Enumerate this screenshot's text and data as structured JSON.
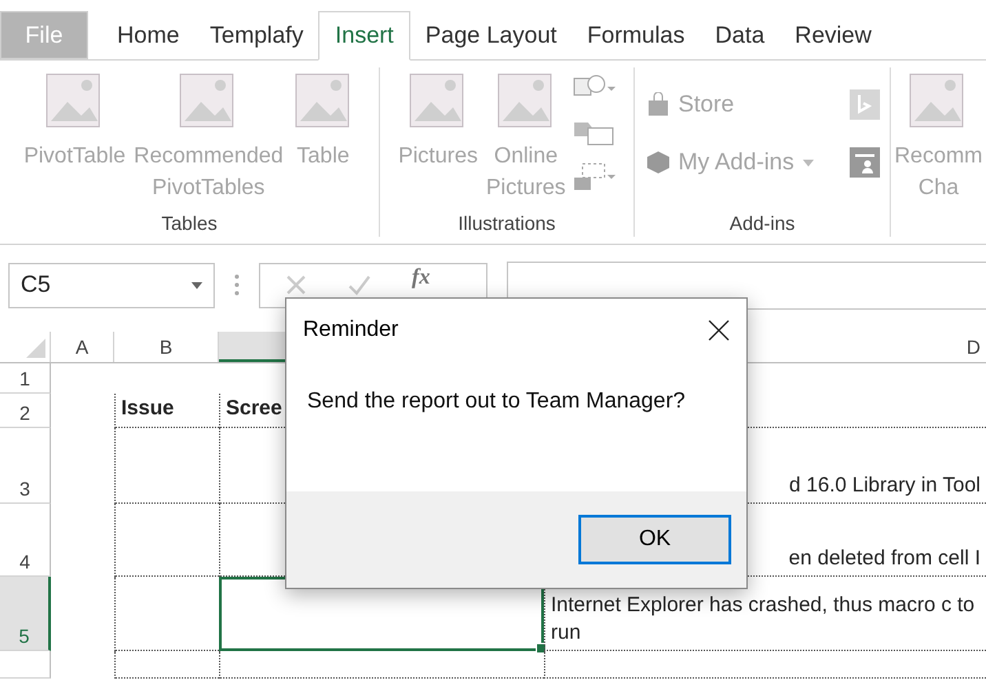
{
  "tabs": [
    {
      "label": "File",
      "kind": "file",
      "selected": false
    },
    {
      "label": "Home",
      "kind": "tab",
      "selected": false
    },
    {
      "label": "Templafy",
      "kind": "tab",
      "selected": false
    },
    {
      "label": "Insert",
      "kind": "tab",
      "selected": true
    },
    {
      "label": "Page Layout",
      "kind": "tab",
      "selected": false
    },
    {
      "label": "Formulas",
      "kind": "tab",
      "selected": false
    },
    {
      "label": "Data",
      "kind": "tab",
      "selected": false
    },
    {
      "label": "Review",
      "kind": "tab",
      "selected": false
    }
  ],
  "ribbon": {
    "groups": [
      {
        "label": "Tables",
        "items": [
          {
            "kind": "large",
            "lines": [
              "PivotTable"
            ]
          },
          {
            "kind": "large",
            "lines": [
              "Recommended",
              "PivotTables"
            ]
          },
          {
            "kind": "large",
            "lines": [
              "Table"
            ]
          }
        ]
      },
      {
        "label": "Illustrations",
        "items": [
          {
            "kind": "large",
            "lines": [
              "Pictures"
            ]
          },
          {
            "kind": "large",
            "lines": [
              "Online",
              "Pictures"
            ]
          },
          {
            "kind": "stack"
          }
        ]
      },
      {
        "label": "Add-ins",
        "items": [
          {
            "kind": "addins",
            "lines": [
              "Store",
              "My Add-ins"
            ]
          }
        ]
      },
      {
        "items": [
          {
            "kind": "large",
            "lines": [
              "Recomm",
              "Cha"
            ]
          }
        ]
      }
    ]
  },
  "formula_bar": {
    "name_box": "C5",
    "function_label": "fx"
  },
  "grid": {
    "columns": [
      {
        "label": "A",
        "selected": false
      },
      {
        "label": "B",
        "selected": false
      },
      {
        "selected": true
      },
      {
        "label": "D",
        "selected": false
      }
    ],
    "rows": [
      {
        "label": "1",
        "kind": "plain",
        "selected": false,
        "cells": [
          "",
          "",
          "",
          ""
        ]
      },
      {
        "label": "2",
        "kind": "header",
        "selected": false,
        "cells": [
          "",
          "Issue",
          "Scree",
          ""
        ]
      },
      {
        "label": "3",
        "kind": "plain",
        "selected": false,
        "cells": [
          "",
          "",
          "",
          "d 16.0 Library in Tool"
        ]
      },
      {
        "label": "4",
        "kind": "plain",
        "selected": false,
        "cells": [
          "",
          "",
          "",
          "en deleted from cell I"
        ]
      },
      {
        "label": "5",
        "kind": "plain",
        "selected": true,
        "cells": [
          "",
          "",
          "",
          "Internet Explorer has crashed, thus macro c to run"
        ]
      }
    ]
  },
  "dialog": {
    "title": "Reminder",
    "message": "Send the report out to Team Manager?",
    "button": "OK"
  }
}
